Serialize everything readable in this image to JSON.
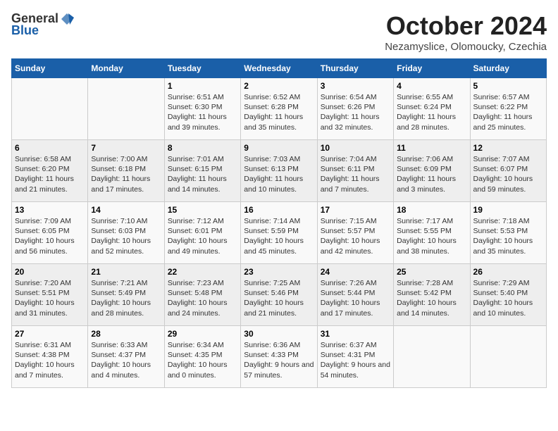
{
  "logo": {
    "general": "General",
    "blue": "Blue"
  },
  "title": "October 2024",
  "subtitle": "Nezamyslice, Olomoucky, Czechia",
  "days_of_week": [
    "Sunday",
    "Monday",
    "Tuesday",
    "Wednesday",
    "Thursday",
    "Friday",
    "Saturday"
  ],
  "weeks": [
    [
      {
        "day": "",
        "info": ""
      },
      {
        "day": "",
        "info": ""
      },
      {
        "day": "1",
        "info": "Sunrise: 6:51 AM\nSunset: 6:30 PM\nDaylight: 11 hours and 39 minutes."
      },
      {
        "day": "2",
        "info": "Sunrise: 6:52 AM\nSunset: 6:28 PM\nDaylight: 11 hours and 35 minutes."
      },
      {
        "day": "3",
        "info": "Sunrise: 6:54 AM\nSunset: 6:26 PM\nDaylight: 11 hours and 32 minutes."
      },
      {
        "day": "4",
        "info": "Sunrise: 6:55 AM\nSunset: 6:24 PM\nDaylight: 11 hours and 28 minutes."
      },
      {
        "day": "5",
        "info": "Sunrise: 6:57 AM\nSunset: 6:22 PM\nDaylight: 11 hours and 25 minutes."
      }
    ],
    [
      {
        "day": "6",
        "info": "Sunrise: 6:58 AM\nSunset: 6:20 PM\nDaylight: 11 hours and 21 minutes."
      },
      {
        "day": "7",
        "info": "Sunrise: 7:00 AM\nSunset: 6:18 PM\nDaylight: 11 hours and 17 minutes."
      },
      {
        "day": "8",
        "info": "Sunrise: 7:01 AM\nSunset: 6:15 PM\nDaylight: 11 hours and 14 minutes."
      },
      {
        "day": "9",
        "info": "Sunrise: 7:03 AM\nSunset: 6:13 PM\nDaylight: 11 hours and 10 minutes."
      },
      {
        "day": "10",
        "info": "Sunrise: 7:04 AM\nSunset: 6:11 PM\nDaylight: 11 hours and 7 minutes."
      },
      {
        "day": "11",
        "info": "Sunrise: 7:06 AM\nSunset: 6:09 PM\nDaylight: 11 hours and 3 minutes."
      },
      {
        "day": "12",
        "info": "Sunrise: 7:07 AM\nSunset: 6:07 PM\nDaylight: 10 hours and 59 minutes."
      }
    ],
    [
      {
        "day": "13",
        "info": "Sunrise: 7:09 AM\nSunset: 6:05 PM\nDaylight: 10 hours and 56 minutes."
      },
      {
        "day": "14",
        "info": "Sunrise: 7:10 AM\nSunset: 6:03 PM\nDaylight: 10 hours and 52 minutes."
      },
      {
        "day": "15",
        "info": "Sunrise: 7:12 AM\nSunset: 6:01 PM\nDaylight: 10 hours and 49 minutes."
      },
      {
        "day": "16",
        "info": "Sunrise: 7:14 AM\nSunset: 5:59 PM\nDaylight: 10 hours and 45 minutes."
      },
      {
        "day": "17",
        "info": "Sunrise: 7:15 AM\nSunset: 5:57 PM\nDaylight: 10 hours and 42 minutes."
      },
      {
        "day": "18",
        "info": "Sunrise: 7:17 AM\nSunset: 5:55 PM\nDaylight: 10 hours and 38 minutes."
      },
      {
        "day": "19",
        "info": "Sunrise: 7:18 AM\nSunset: 5:53 PM\nDaylight: 10 hours and 35 minutes."
      }
    ],
    [
      {
        "day": "20",
        "info": "Sunrise: 7:20 AM\nSunset: 5:51 PM\nDaylight: 10 hours and 31 minutes."
      },
      {
        "day": "21",
        "info": "Sunrise: 7:21 AM\nSunset: 5:49 PM\nDaylight: 10 hours and 28 minutes."
      },
      {
        "day": "22",
        "info": "Sunrise: 7:23 AM\nSunset: 5:48 PM\nDaylight: 10 hours and 24 minutes."
      },
      {
        "day": "23",
        "info": "Sunrise: 7:25 AM\nSunset: 5:46 PM\nDaylight: 10 hours and 21 minutes."
      },
      {
        "day": "24",
        "info": "Sunrise: 7:26 AM\nSunset: 5:44 PM\nDaylight: 10 hours and 17 minutes."
      },
      {
        "day": "25",
        "info": "Sunrise: 7:28 AM\nSunset: 5:42 PM\nDaylight: 10 hours and 14 minutes."
      },
      {
        "day": "26",
        "info": "Sunrise: 7:29 AM\nSunset: 5:40 PM\nDaylight: 10 hours and 10 minutes."
      }
    ],
    [
      {
        "day": "27",
        "info": "Sunrise: 6:31 AM\nSunset: 4:38 PM\nDaylight: 10 hours and 7 minutes."
      },
      {
        "day": "28",
        "info": "Sunrise: 6:33 AM\nSunset: 4:37 PM\nDaylight: 10 hours and 4 minutes."
      },
      {
        "day": "29",
        "info": "Sunrise: 6:34 AM\nSunset: 4:35 PM\nDaylight: 10 hours and 0 minutes."
      },
      {
        "day": "30",
        "info": "Sunrise: 6:36 AM\nSunset: 4:33 PM\nDaylight: 9 hours and 57 minutes."
      },
      {
        "day": "31",
        "info": "Sunrise: 6:37 AM\nSunset: 4:31 PM\nDaylight: 9 hours and 54 minutes."
      },
      {
        "day": "",
        "info": ""
      },
      {
        "day": "",
        "info": ""
      }
    ]
  ]
}
